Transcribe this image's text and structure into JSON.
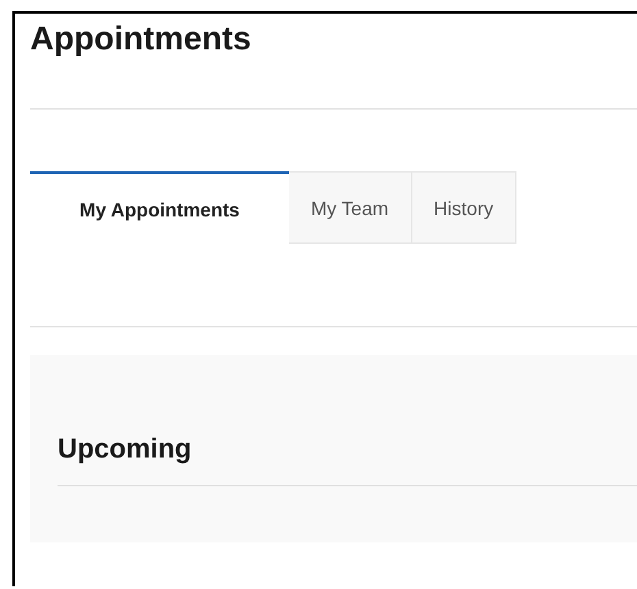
{
  "page": {
    "title": "Appointments"
  },
  "tabs": [
    {
      "label": "My Appointments",
      "selected": true
    },
    {
      "label": "My Team",
      "selected": false
    },
    {
      "label": "History",
      "selected": false
    }
  ],
  "section": {
    "title": "Upcoming"
  }
}
